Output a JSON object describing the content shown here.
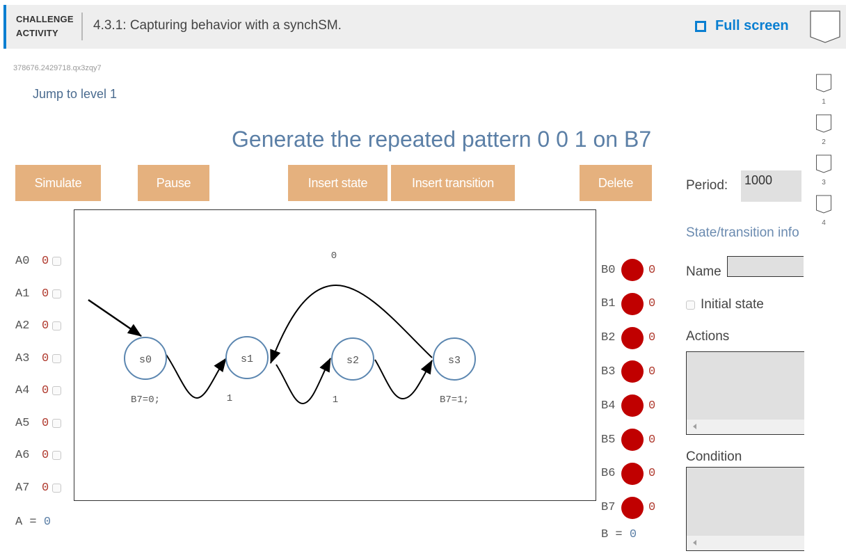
{
  "header": {
    "challenge_label_line1": "CHALLENGE",
    "challenge_label_line2": "ACTIVITY",
    "title": "4.3.1: Capturing behavior with a synchSM.",
    "fullscreen_label": "Full screen",
    "accent_color": "#0a7fd1"
  },
  "activity_id": "378676.2429718.qx3zqy7",
  "jump_link": "Jump to level 1",
  "levels": [
    {
      "label": "1",
      "completed": false
    },
    {
      "label": "2",
      "completed": false
    },
    {
      "label": "3",
      "completed": false
    },
    {
      "label": "4",
      "completed": false
    }
  ],
  "prompt": "Generate the repeated pattern 0 0 1 on B7",
  "toolbar": {
    "simulate": "Simulate",
    "pause": "Pause",
    "insert_state": "Insert state",
    "insert_transition": "Insert transition",
    "delete": "Delete",
    "button_color": "#e5b17e"
  },
  "period": {
    "label": "Period:",
    "value": "1000"
  },
  "inputs": {
    "rows": [
      {
        "name": "A0",
        "value": "0",
        "checked": false
      },
      {
        "name": "A1",
        "value": "0",
        "checked": false
      },
      {
        "name": "A2",
        "value": "0",
        "checked": false
      },
      {
        "name": "A3",
        "value": "0",
        "checked": false
      },
      {
        "name": "A4",
        "value": "0",
        "checked": false
      },
      {
        "name": "A5",
        "value": "0",
        "checked": false
      },
      {
        "name": "A6",
        "value": "0",
        "checked": false
      },
      {
        "name": "A7",
        "value": "0",
        "checked": false
      }
    ],
    "total_label": "A =",
    "total_value": "0"
  },
  "outputs": {
    "rows": [
      {
        "name": "B0",
        "value": "0"
      },
      {
        "name": "B1",
        "value": "0"
      },
      {
        "name": "B2",
        "value": "0"
      },
      {
        "name": "B3",
        "value": "0"
      },
      {
        "name": "B4",
        "value": "0"
      },
      {
        "name": "B5",
        "value": "0"
      },
      {
        "name": "B6",
        "value": "0"
      },
      {
        "name": "B7",
        "value": "0"
      }
    ],
    "led_color": "#c00000",
    "total_label": "B =",
    "total_value": "0"
  },
  "state_machine": {
    "states": [
      {
        "name": "s0",
        "initial": true,
        "action": "B7=0;"
      },
      {
        "name": "s1",
        "initial": false,
        "action": ""
      },
      {
        "name": "s2",
        "initial": false,
        "action": ""
      },
      {
        "name": "s3",
        "initial": false,
        "action": "B7=1;"
      }
    ],
    "transitions": [
      {
        "from": "s0",
        "to": "s1",
        "condition": "1"
      },
      {
        "from": "s1",
        "to": "s2",
        "condition": "1"
      },
      {
        "from": "s2",
        "to": "s3",
        "condition": ""
      },
      {
        "from": "s3",
        "to": "s1",
        "condition": "0"
      }
    ],
    "state_color": "#5b86b0"
  },
  "info_panel": {
    "title": "State/transition info",
    "name_label": "Name",
    "name_value": "",
    "initial_state_label": "Initial state",
    "initial_state_checked": false,
    "actions_label": "Actions",
    "actions_value": "",
    "condition_label": "Condition",
    "condition_value": ""
  }
}
